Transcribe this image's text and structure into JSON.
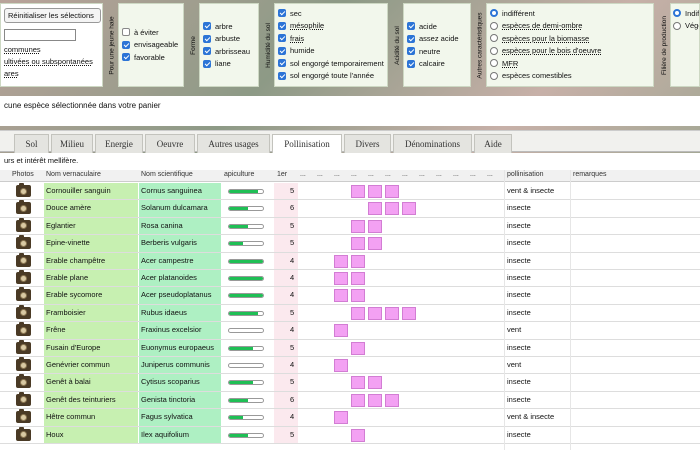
{
  "filters": {
    "reset_label": "Réinitialiser les sélections",
    "links": [
      "communes",
      "ultivées ou subspontanées",
      "ares"
    ],
    "haie": {
      "title": "Pour une jeune haie",
      "options": [
        {
          "label": "à éviter",
          "checked": false
        },
        {
          "label": "envisageable",
          "checked": true
        },
        {
          "label": "favorable",
          "checked": true
        }
      ]
    },
    "forme": {
      "title": "Forme",
      "options": [
        {
          "label": "arbre",
          "checked": true
        },
        {
          "label": "arbuste",
          "checked": true
        },
        {
          "label": "arbrisseau",
          "checked": true
        },
        {
          "label": "liane",
          "checked": true
        }
      ]
    },
    "humidite": {
      "title": "Humidité du sol",
      "options": [
        {
          "label": "sec",
          "checked": true
        },
        {
          "label": "mésophile",
          "checked": true
        },
        {
          "label": "frais",
          "checked": true
        },
        {
          "label": "humide",
          "checked": true
        },
        {
          "label": "sol engorgé temporairement",
          "checked": true
        },
        {
          "label": "sol engorgé toute l'année",
          "checked": true
        }
      ]
    },
    "acidite": {
      "title": "Acidité du sol",
      "options": [
        {
          "label": "acide",
          "checked": true
        },
        {
          "label": "assez acide",
          "checked": true
        },
        {
          "label": "neutre",
          "checked": true
        },
        {
          "label": "calcaire",
          "checked": true
        }
      ]
    },
    "autres": {
      "title": "Autres caractéristiques",
      "options": [
        {
          "label": "indifférent",
          "checked": true
        },
        {
          "label": "espèces de demi-ombre",
          "checked": false
        },
        {
          "label": "espèces pour la biomasse",
          "checked": false
        },
        {
          "label": "espèces pour le bois d'oeuvre",
          "checked": false
        },
        {
          "label": "MFR",
          "checked": false
        },
        {
          "label": "espèces comestibles",
          "checked": false
        }
      ]
    },
    "filiere": {
      "title": "Filière de production",
      "options": [
        {
          "label": "Indiff",
          "checked": true
        },
        {
          "label": "Végé",
          "checked": false
        }
      ]
    }
  },
  "panier_text": "cune espèce sélectionnée dans votre panier",
  "tabs": [
    {
      "label": "Sol",
      "active": false
    },
    {
      "label": "Milieu",
      "active": false
    },
    {
      "label": "Energie",
      "active": false
    },
    {
      "label": "Oeuvre",
      "active": false
    },
    {
      "label": "Autres usages",
      "active": false
    },
    {
      "label": "Pollinisation",
      "active": true
    },
    {
      "label": "Divers",
      "active": false
    },
    {
      "label": "Dénominations",
      "active": false
    },
    {
      "label": "Aide",
      "active": false
    }
  ],
  "info_text": "urs et intérêt mellifère.",
  "table": {
    "headers": {
      "photos": "Photos",
      "vern": "Nom vernaculaire",
      "sci": "Nom scientifique",
      "apic": "apiculture",
      "first": "1er",
      "dots": "...",
      "poll": "pollinisation",
      "rem": "remarques"
    },
    "rows": [
      {
        "vern": "Cornouiller sanguin",
        "sci": "Cornus sanguinea",
        "apic": 0.85,
        "first": "5",
        "months": [
          4,
          5,
          6
        ],
        "poll": "vent & insecte",
        "rem": ""
      },
      {
        "vern": "Douce amère",
        "sci": "Solanum dulcamara",
        "apic": 0.55,
        "first": "6",
        "months": [
          5,
          6,
          7
        ],
        "poll": "insecte",
        "rem": ""
      },
      {
        "vern": "Eglantier",
        "sci": "Rosa canina",
        "apic": 0.55,
        "first": "5",
        "months": [
          4,
          5
        ],
        "poll": "insecte",
        "rem": ""
      },
      {
        "vern": "Epine-vinette",
        "sci": "Berberis vulgaris",
        "apic": 0.4,
        "first": "5",
        "months": [
          4,
          5
        ],
        "poll": "insecte",
        "rem": ""
      },
      {
        "vern": "Erable champêtre",
        "sci": "Acer campestre",
        "apic": 1.0,
        "first": "4",
        "months": [
          3,
          4
        ],
        "poll": "insecte",
        "rem": ""
      },
      {
        "vern": "Erable plane",
        "sci": "Acer platanoides",
        "apic": 1.0,
        "first": "4",
        "months": [
          3,
          4
        ],
        "poll": "insecte",
        "rem": ""
      },
      {
        "vern": "Erable sycomore",
        "sci": "Acer pseudoplatanus",
        "apic": 1.0,
        "first": "4",
        "months": [
          3,
          4
        ],
        "poll": "insecte",
        "rem": ""
      },
      {
        "vern": "Framboisier",
        "sci": "Rubus idaeus",
        "apic": 0.85,
        "first": "5",
        "months": [
          4,
          5,
          6,
          7
        ],
        "poll": "insecte",
        "rem": ""
      },
      {
        "vern": "Frêne",
        "sci": "Fraxinus excelsior",
        "apic": 0.0,
        "first": "4",
        "months": [
          3
        ],
        "poll": "vent",
        "rem": ""
      },
      {
        "vern": "Fusain d'Europe",
        "sci": "Euonymus europaeus",
        "apic": 0.7,
        "first": "5",
        "months": [
          4
        ],
        "poll": "insecte",
        "rem": ""
      },
      {
        "vern": "Genévrier commun",
        "sci": "Juniperus communis",
        "apic": 0.0,
        "first": "4",
        "months": [
          3
        ],
        "poll": "vent",
        "rem": ""
      },
      {
        "vern": "Genêt à balai",
        "sci": "Cytisus scoparius",
        "apic": 0.7,
        "first": "5",
        "months": [
          4,
          5
        ],
        "poll": "insecte",
        "rem": ""
      },
      {
        "vern": "Genêt des teinturiers",
        "sci": "Genista tinctoria",
        "apic": 0.55,
        "first": "6",
        "months": [
          4,
          5,
          6
        ],
        "poll": "insecte",
        "rem": ""
      },
      {
        "vern": "Hêtre commun",
        "sci": "Fagus sylvatica",
        "apic": 0.4,
        "first": "4",
        "months": [
          3
        ],
        "poll": "vent & insecte",
        "rem": ""
      },
      {
        "vern": "Houx",
        "sci": "Ilex aquifolium",
        "apic": 0.55,
        "first": "5",
        "months": [
          4
        ],
        "poll": "insecte",
        "rem": ""
      }
    ]
  }
}
